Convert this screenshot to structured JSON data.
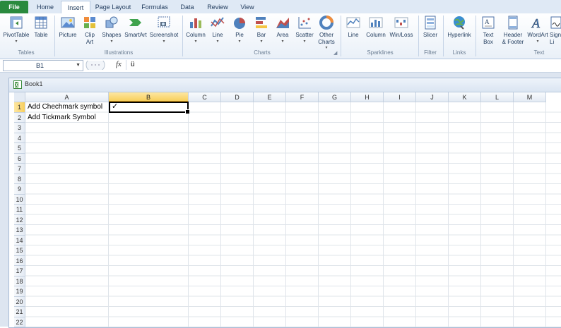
{
  "tabs": {
    "file": "File",
    "home": "Home",
    "insert": "Insert",
    "page_layout": "Page Layout",
    "formulas": "Formulas",
    "data": "Data",
    "review": "Review",
    "view": "View"
  },
  "ribbon": {
    "tables": {
      "pivot": "PivotTable",
      "table": "Table",
      "group": "Tables"
    },
    "illustrations": {
      "picture": "Picture",
      "clipart1": "Clip",
      "clipart2": "Art",
      "shapes": "Shapes",
      "smartart": "SmartArt",
      "screenshot": "Screenshot",
      "group": "Illustrations"
    },
    "charts": {
      "column": "Column",
      "line": "Line",
      "pie": "Pie",
      "bar": "Bar",
      "area": "Area",
      "scatter": "Scatter",
      "other1": "Other",
      "other2": "Charts",
      "group": "Charts"
    },
    "sparklines": {
      "line": "Line",
      "column": "Column",
      "winloss": "Win/Loss",
      "group": "Sparklines"
    },
    "filter": {
      "slicer": "Slicer",
      "group": "Filter"
    },
    "links": {
      "hyperlink": "Hyperlink",
      "group": "Links"
    },
    "text": {
      "textbox1": "Text",
      "textbox2": "Box",
      "header1": "Header",
      "header2": "& Footer",
      "wordart": "WordArt",
      "sig1": "Sign",
      "sig2": "Li",
      "group": "Text"
    }
  },
  "formula_bar": {
    "name_box": "B1",
    "fx": "fx",
    "content": "ü"
  },
  "workbook": {
    "title": "Book1"
  },
  "columns": [
    "A",
    "B",
    "C",
    "D",
    "E",
    "F",
    "G",
    "H",
    "I",
    "J",
    "K",
    "L",
    "M"
  ],
  "rows": [
    "1",
    "2",
    "3",
    "4",
    "5",
    "6",
    "7",
    "8",
    "9",
    "10",
    "11",
    "12",
    "13",
    "14",
    "15",
    "16",
    "17",
    "18",
    "19",
    "20",
    "21",
    "22"
  ],
  "cells": {
    "A1": "Add Chechmark symbol",
    "B1": "✓",
    "A2": "Add Tickmark Symbol"
  },
  "colors": {
    "file_tab": "#2a8a3e",
    "selection": "#f8cf5c",
    "ribbon_bg": "#dfe9f5"
  }
}
